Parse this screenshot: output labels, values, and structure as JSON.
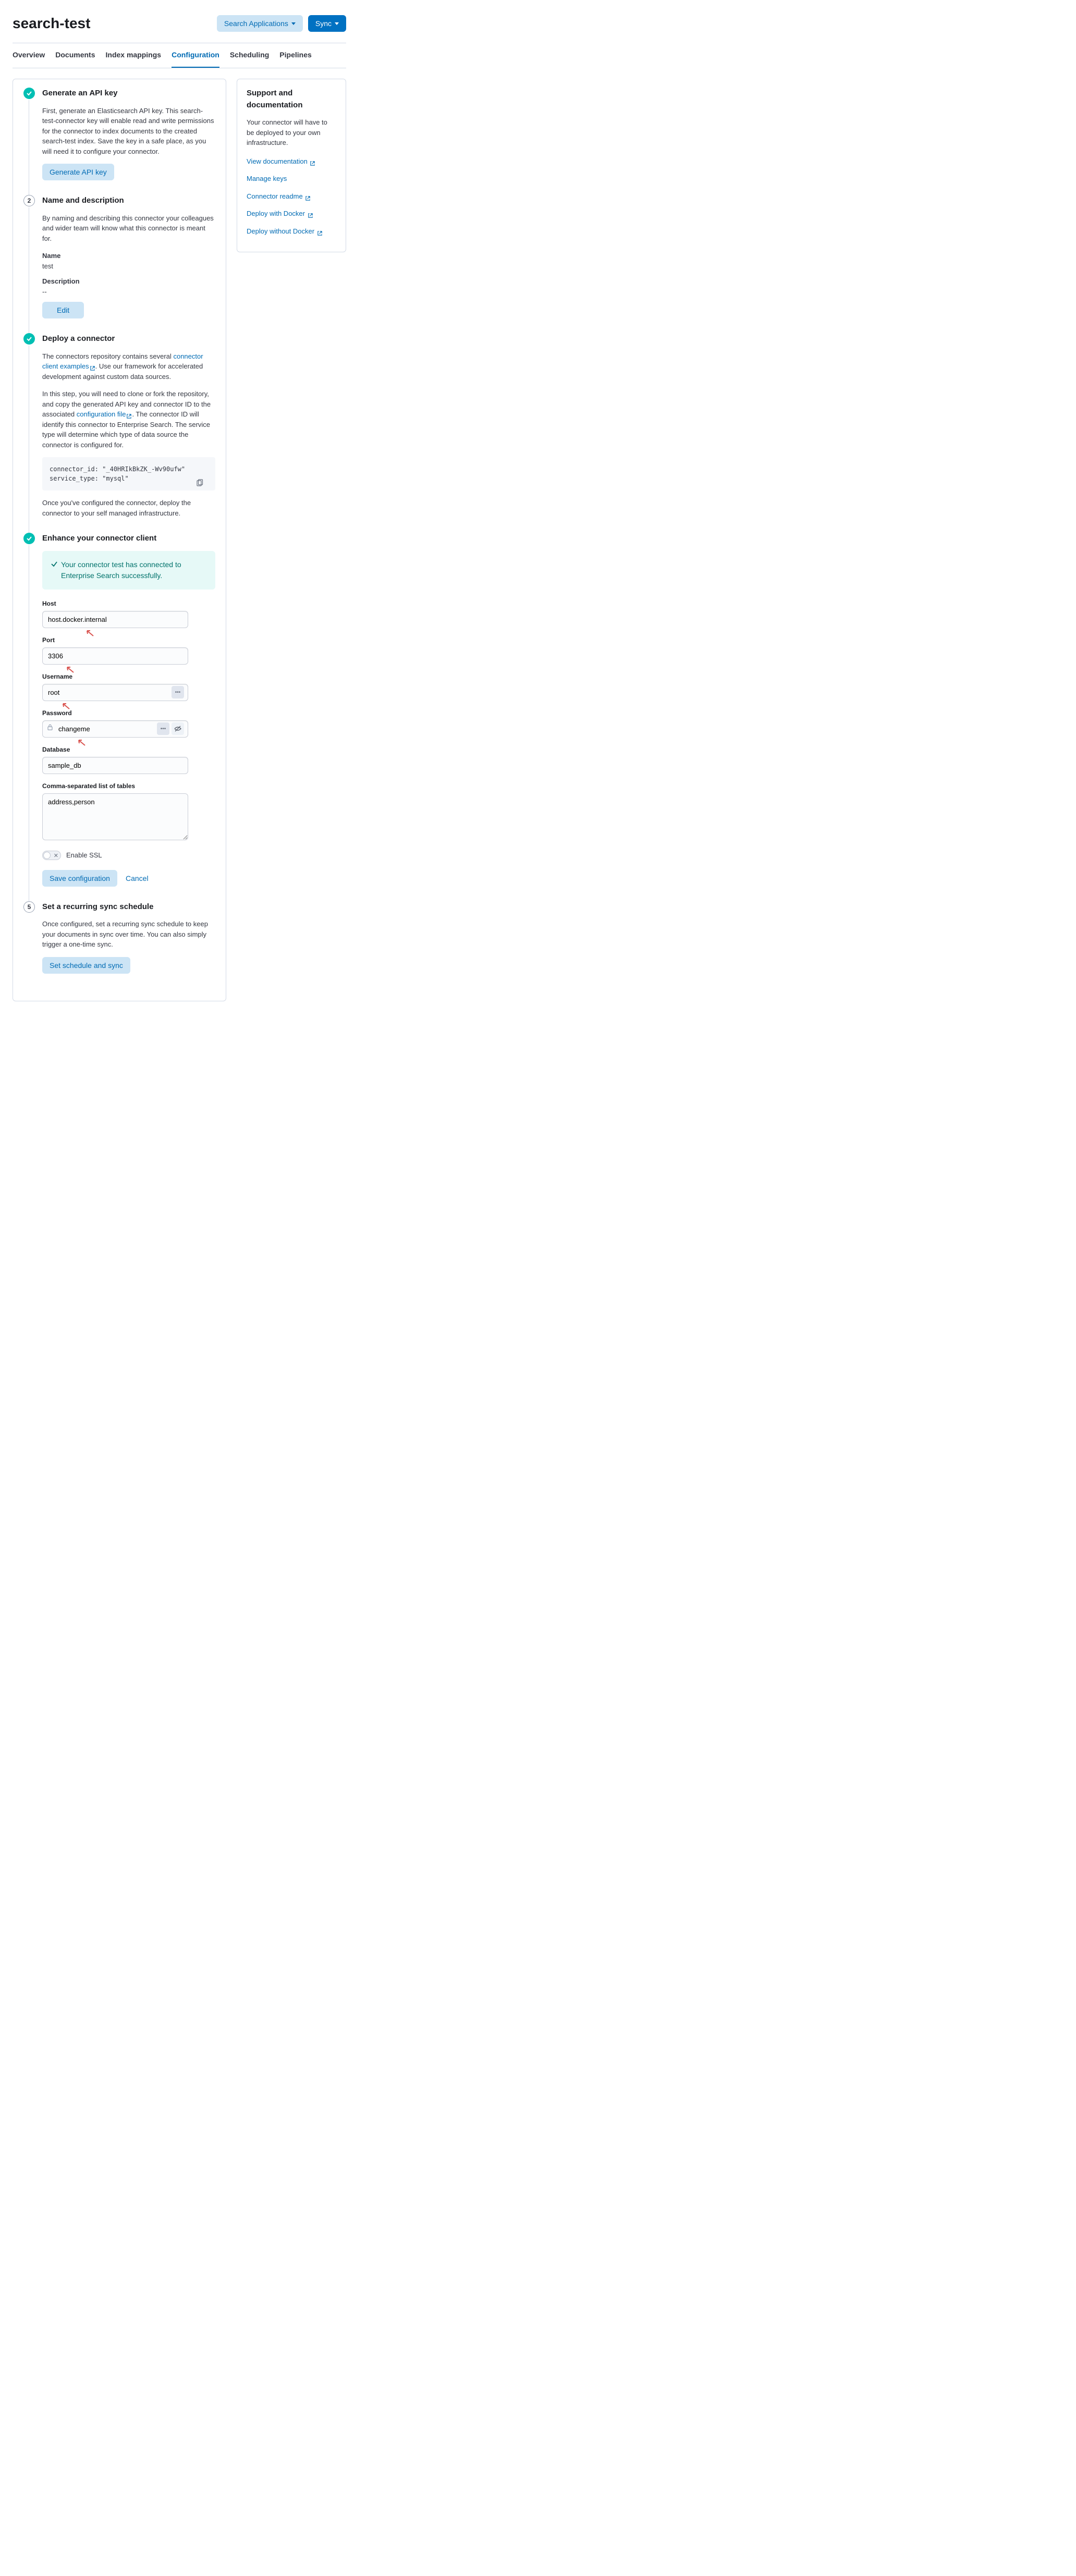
{
  "header": {
    "title": "search-test",
    "search_apps_label": "Search Applications",
    "sync_label": "Sync"
  },
  "tabs": [
    "Overview",
    "Documents",
    "Index mappings",
    "Configuration",
    "Scheduling",
    "Pipelines"
  ],
  "active_tab": "Configuration",
  "sidebar": {
    "title": "Support and documentation",
    "description": "Your connector will have to be deployed to your own infrastructure.",
    "links": [
      "View documentation",
      "Manage keys",
      "Connector readme",
      "Deploy with Docker",
      "Deploy without Docker"
    ]
  },
  "steps": {
    "api_key": {
      "title": "Generate an API key",
      "desc": "First, generate an Elasticsearch API key. This search-test-connector key will enable read and write permissions for the connector to index documents to the created search-test index. Save the key in a safe place, as you will need it to configure your connector.",
      "button": "Generate API key"
    },
    "name_desc": {
      "title": "Name and description",
      "desc": "By naming and describing this connector your colleagues and wider team will know what this connector is meant for.",
      "name_label": "Name",
      "name_value": "test",
      "desc_label": "Description",
      "desc_value": "--",
      "edit_button": "Edit"
    },
    "deploy": {
      "title": "Deploy a connector",
      "p1a": "The connectors repository contains several ",
      "p1_link": "connector client examples",
      "p1b": ". Use our framework for accelerated development against custom data sources.",
      "p2a": "In this step, you will need to clone or fork the repository, and copy the generated API key and connector ID to the associated ",
      "p2_link": "configuration file",
      "p2b": ". The connector ID will identify this connector to Enterprise Search. The service type will determine which type of data source the connector is configured for.",
      "code": "connector_id: \"_40HRIkBkZK_-Wv90ufw\"\nservice_type: \"mysql\"",
      "p3": "Once you've configured the connector, deploy the connector to your self managed infrastructure."
    },
    "enhance": {
      "title": "Enhance your connector client",
      "callout": "Your connector test has connected to Enterprise Search successfully.",
      "fields": {
        "host_label": "Host",
        "host_value": "host.docker.internal",
        "port_label": "Port",
        "port_value": "3306",
        "user_label": "Username",
        "user_value": "root",
        "pass_label": "Password",
        "pass_value": "changeme",
        "db_label": "Database",
        "db_value": "sample_db",
        "tables_label": "Comma-separated list of tables",
        "tables_value": "address,person",
        "ssl_label": "Enable SSL"
      },
      "save_button": "Save configuration",
      "cancel_button": "Cancel"
    },
    "schedule": {
      "title": "Set a recurring sync schedule",
      "desc": "Once configured, set a recurring sync schedule to keep your documents in sync over time. You can also simply trigger a one-time sync.",
      "button": "Set schedule and sync"
    }
  }
}
